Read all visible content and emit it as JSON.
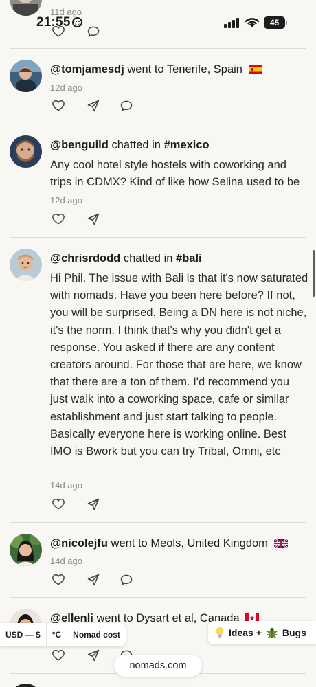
{
  "status_bar": {
    "time": "21:55",
    "battery": "45"
  },
  "previous_item": {
    "timestamp": "11d ago"
  },
  "feed": [
    {
      "handle": "@tomjamesdj",
      "verb": "went to",
      "place": "Tenerife, Spain",
      "flag": "spain-flag",
      "timestamp": "12d ago"
    },
    {
      "handle": "@benguild",
      "verb": "chatted in",
      "channel": "#mexico",
      "message": "Any cool hotel style hostels with coworking and trips in CDMX? Kind of like how Selina used to be",
      "timestamp": "12d ago"
    },
    {
      "handle": "@chrisrdodd",
      "verb": "chatted in",
      "channel": "#bali",
      "message": "Hi Phil. The issue with Bali is that it's now saturated with nomads. Have you been here before? If not, you will be surprised. Being a DN here is not niche, it's the norm. I think that's why you didn't get a response. You asked if there are any content creators around. For those that are here, we know that there are a ton of them. I'd recommend you just walk into a coworking space, cafe or similar establishment and just start talking to people. Basically everyone here is working online. Best IMO is Bwork but you can try Tribal, Omni, etc",
      "timestamp": "14d ago"
    },
    {
      "handle": "@nicolejfu",
      "verb": "went to",
      "place": "Meols, United Kingdom",
      "flag": "uk-flag",
      "timestamp": "14d ago"
    },
    {
      "handle": "@ellenli",
      "verb": "went to",
      "place": "Dysart et al, Canada",
      "flag": "canada-flag"
    }
  ],
  "bottom_bar": {
    "currency": "USD — $",
    "unit": "°C",
    "cost": "Nomad cost",
    "ideas": "Ideas +",
    "bugs": "Bugs",
    "site": "nomads.com"
  },
  "colors": {
    "background": "#f8f7f4",
    "divider": "#dedcd8",
    "muted": "#8a8a8a"
  }
}
